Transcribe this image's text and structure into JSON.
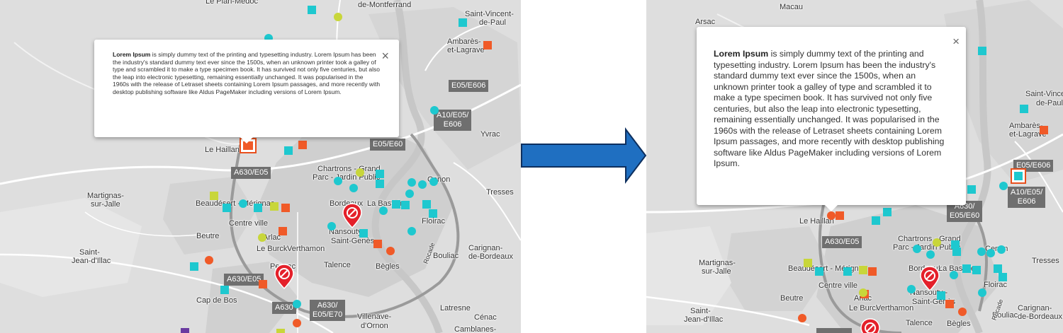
{
  "popup": {
    "title": "Lorem Ipsum",
    "body": " is simply dummy text of the printing and typesetting industry. Lorem Ipsum has been the industry's standard dummy text ever since the 1500s, when an unknown printer took a galley of type and scrambled it to make a type specimen book. It has survived not only five centuries, but also the leap into electronic typesetting, remaining essentially unchanged. It was popularised in the 1960s with the release of Letraset sheets containing Lorem Ipsum passages, and more recently with desktop publishing software like Aldus PageMaker including versions of Lorem Ipsum.",
    "close": "×"
  },
  "colors": {
    "teal": "#1ec8cf",
    "orange": "#f05a28",
    "lime": "#c8d63a",
    "purple": "#6a3aa0",
    "pin": "#e4202a",
    "arrow": "#1f6fc1"
  },
  "left_map": {
    "places": {
      "le_pian_medoc": "Le Pian-Médoc",
      "de_montferrand": "de-Montferrand",
      "saint_vincent": "Saint-Vincent-",
      "de_paul": "de-Paul",
      "ambares": "Ambarès-",
      "et_lagrave": "et-Lagrave",
      "yvrac": "Yvrac",
      "le_haillan": "Le Haillan",
      "chartrons": "Chartrons - Grand",
      "parc": "Parc - Jardin Public",
      "cenon": "Cenon",
      "tresses": "Tresses",
      "martignas": "Martignas-",
      "sur_jalle": "sur-Jalle",
      "beaudesert": "Beaudésert - Mérignac",
      "centre_ville": "Centre ville",
      "bordeaux": "Bordeaux",
      "la_bastide": "La Bastide",
      "floirac": "Floirac",
      "beutre": "Beutre",
      "arlac": "Arlac",
      "nansouty": "Nansouty -",
      "saint_genes": "Saint-Genès",
      "le_burck": "Le Burck",
      "verthamon": "Verthamon",
      "bouliac": "Bouliac",
      "carignan": "Carignan-",
      "de_bordeaux": "de-Bordeaux",
      "saint": "Saint-",
      "jean_illac": "Jean-d'Illac",
      "pessac": "Pessac",
      "talence": "Talence",
      "begles": "Bègles",
      "cap_de_bos": "Cap de Bos",
      "latresne": "Latresne",
      "cenac": "Cénac",
      "villenave": "Villenave-",
      "d_ornon": "d'Ornon",
      "camblanes": "Camblanes-",
      "rocade": "Rocade"
    },
    "roads": {
      "e05_e606": "E05/E606",
      "a10_e05": "A10/E05/",
      "e606": "E606",
      "a630_e05_left": "A630/E05",
      "e05_e60": "E05/E60",
      "a630_e05_low": "A630/E05",
      "a630": "A630",
      "a630_e70": "A630/",
      "e05_e70": "E05/E70"
    }
  },
  "right_map": {
    "places": {
      "macau": "Macau",
      "arsac": "Arsac",
      "saint_vincent": "Saint-Vincent-",
      "de_paul": "de-Paul",
      "ambares": "Ambarès-",
      "et_lagrave": "et-Lagrave",
      "le_haillan": "Le Haillan",
      "chartrons": "Chartrons - Grand",
      "parc": "Parc - Jardin Public",
      "cenon": "Cenon",
      "tresses": "Tresses",
      "martignas": "Martignas-",
      "sur_jalle": "sur-Jalle",
      "beaudesert": "Beaudésert - Mérignac",
      "centre_ville": "Centre ville",
      "bordeaux": "Bordeaux",
      "la_bastide": "La Bastide",
      "floirac": "Floirac",
      "beutre": "Beutre",
      "arlac": "Arlac",
      "nansouty": "Nansouty -",
      "saint_genes": "Saint-Genès",
      "le_burck": "Le Burck",
      "verthamon": "Verthamon",
      "bouliac": "Bouliac",
      "carignan": "Carignan-",
      "de_bordeaux": "de-Bordeaux",
      "saint": "Saint-",
      "jean_illac": "Jean-d'Illac",
      "talence": "Talence",
      "begles": "Bègles",
      "rocade": "Rocade"
    },
    "roads": {
      "e05_e606": "E05/E606",
      "a10_e05": "A10/E05/",
      "e606": "E606",
      "a630_e05": "A630/E05",
      "e05_e60_a": "A630/",
      "e05_e60_b": "E05/E60"
    }
  }
}
